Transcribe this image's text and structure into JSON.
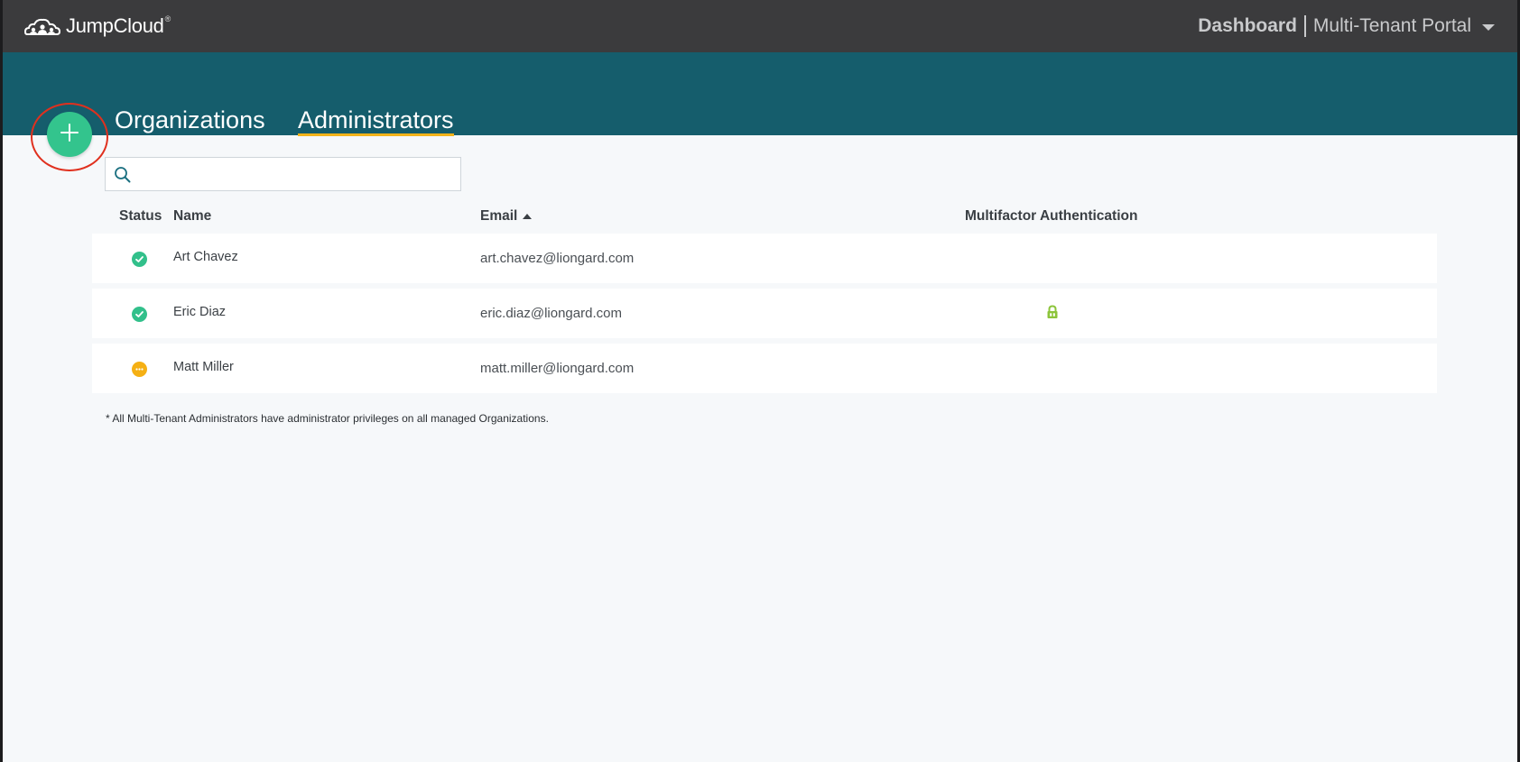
{
  "app": {
    "logo_text": "JumpCloud",
    "logo_mark": "®"
  },
  "topnav": {
    "dashboard_label": "Dashboard",
    "portal_label": "Multi-Tenant Portal"
  },
  "tabs": [
    {
      "label": "Organizations",
      "active": false
    },
    {
      "label": "Administrators",
      "active": true
    }
  ],
  "search": {
    "value": "",
    "placeholder": ""
  },
  "table": {
    "columns": {
      "status": "Status",
      "name": "Name",
      "email": "Email",
      "mfa": "Multifactor Authentication"
    },
    "sort": {
      "column": "email",
      "direction": "ascending"
    },
    "rows": [
      {
        "status": "active",
        "name": "Art Chavez",
        "email": "art.chavez@liongard.com",
        "mfa": false
      },
      {
        "status": "active",
        "name": "Eric Diaz",
        "email": "eric.diaz@liongard.com",
        "mfa": true
      },
      {
        "status": "pending",
        "name": "Matt Miller",
        "email": "matt.miller@liongard.com",
        "mfa": false
      }
    ]
  },
  "footnote": "* All Multi-Tenant Administrators have administrator privileges on all managed Organizations.",
  "colors": {
    "topbar": "#3b3b3d",
    "header_band": "#155d6c",
    "tab_underline": "#f2b31a",
    "add_button": "#33c48d",
    "highlight_ring": "#e0301e",
    "status_active": "#32c08b",
    "status_pending": "#f5b014",
    "mfa_lock": "#8cc43a"
  },
  "icons": {
    "logo": "jumpcloud-cloud-logo",
    "add": "plus-icon",
    "search": "search-icon",
    "caret": "caret-down-icon",
    "sort": "sort-ascending-icon",
    "status_active": "check-circle-icon",
    "status_pending": "ellipsis-circle-icon",
    "mfa": "lock-icon"
  }
}
